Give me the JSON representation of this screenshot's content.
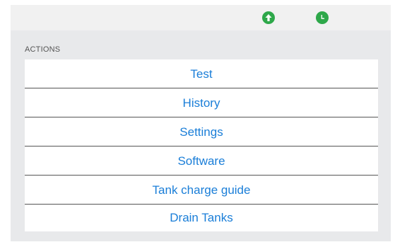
{
  "topbar": {
    "icons": [
      "upload-status-icon",
      "clock-status-icon"
    ],
    "icon_color": "#2ea84a"
  },
  "actions": {
    "header": "ACTIONS",
    "items": [
      {
        "label": "Test"
      },
      {
        "label": "History"
      },
      {
        "label": "Settings"
      },
      {
        "label": "Software"
      },
      {
        "label": "Tank charge guide"
      },
      {
        "label": "Drain Tanks"
      }
    ],
    "link_color": "#1a7ed8"
  }
}
